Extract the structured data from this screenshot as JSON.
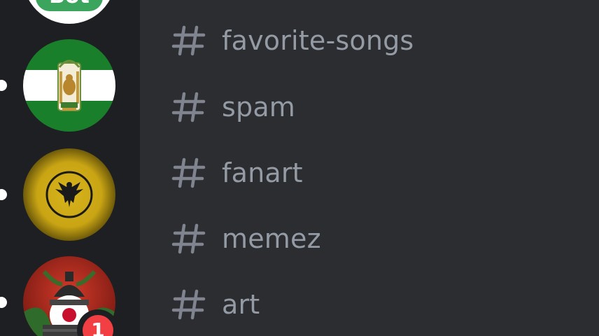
{
  "servers": [
    {
      "name": "server-partial-top",
      "icon": "green-server-icon",
      "color": "#57f287"
    },
    {
      "name": "andalusia-server",
      "icon": "andalusia-flag-icon",
      "colors": [
        "#1b7a1b",
        "#ffffff"
      ]
    },
    {
      "name": "eagle-server",
      "icon": "eagle-emblem-icon",
      "color": "#c9a514"
    },
    {
      "name": "samurai-server",
      "icon": "samurai-countryball-icon",
      "color": "#b32222",
      "mention_badge": "1"
    }
  ],
  "channels": [
    {
      "icon": "hash-icon",
      "label": "favorite-songs"
    },
    {
      "icon": "hash-icon",
      "label": "spam"
    },
    {
      "icon": "hash-icon",
      "label": "fanart"
    },
    {
      "icon": "hash-icon",
      "label": "memez"
    },
    {
      "icon": "hash-icon",
      "label": "art"
    }
  ],
  "colors": {
    "rail_bg": "#1e1f22",
    "pane_bg": "#2b2d31",
    "channel_text": "#949ba4",
    "badge": "#f23f43",
    "pill": "#ffffff"
  }
}
